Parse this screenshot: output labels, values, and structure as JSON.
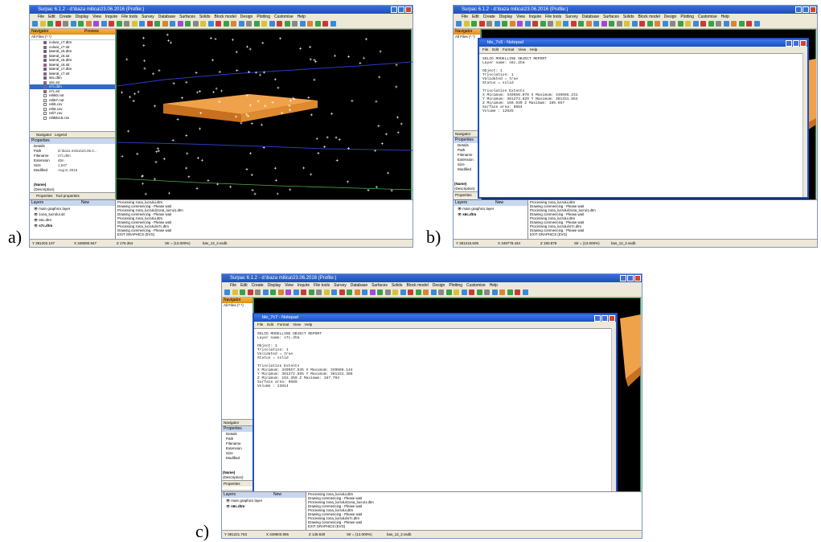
{
  "labels": {
    "a": "a)",
    "b": "b)",
    "c": "c)"
  },
  "app": {
    "titles": {
      "a": "Surpac 6.1.2 - d:\\baza mitica\\23.06.2016 (Profile:)",
      "b": "Surpac 6.1.2 - d:\\baza mitica\\23.06.2016 (Profile:)",
      "c": "Surpac 6.1.2 - d:\\baza mitica\\23.06.2016 (Profile:)"
    },
    "menu": [
      "File",
      "Edit",
      "Create",
      "Display",
      "View",
      "Inquire",
      "File tools",
      "Survey",
      "Database",
      "Surfaces",
      "Solids",
      "Block model",
      "Design",
      "Plotting",
      "Customise",
      "Help"
    ],
    "navigator": {
      "title": "Navigator",
      "preview": "Preview",
      "filter": "All Files (*.*)"
    },
    "files": [
      "culoar_c7.dtm",
      "culoar_c7.str",
      "lateral_c5.dtm",
      "lateral_c5.str",
      "lateral_c6.dtm",
      "lateral_c6.str",
      "lateral_c7.dtm",
      "lateral_c7.str",
      "s6c.dtm",
      "s6c.str",
      "s7c.dtm",
      "s7c.str",
      "reli60.not",
      "reli67.not",
      "reli5.csv",
      "reli6.csv",
      "reli7.csv",
      "reliBloc5.csv"
    ],
    "selected_file": "s7c.dtm",
    "nav_tabs": [
      "Navigator",
      "Legend"
    ],
    "properties": {
      "title": "Properties",
      "section": "Details",
      "rows": [
        {
          "k": "Path",
          "v": "D:\\baza mitica\\23.06.2..."
        },
        {
          "k": "Filename",
          "v": "s7c.dtm"
        },
        {
          "k": "Extension",
          "v": "dtm"
        },
        {
          "k": "Size",
          "v": "1,547"
        },
        {
          "k": "Modified",
          "v": "Aug 8, 2016"
        }
      ],
      "name_hint": "(Name)",
      "desc_hint": "(Description)",
      "tabs": [
        "Properties",
        "Tool properties"
      ]
    },
    "layers": {
      "title": "Layers",
      "new": "New",
      "items_a": [
        "main graphics layer",
        "zona_lucrului.str",
        "s6c.dtm",
        "s7c.dtm"
      ],
      "items_bc": [
        "main graphics layer",
        "s6c.dtm"
      ]
    },
    "log": [
      "Processing zona_lucrului.dtm",
      "Drawing commencing - Please wait",
      "Processing zona_lucrului\\zona_lucrui1.dtm",
      "Drawing commencing - Please wait",
      "Processing zona_lucrului.dtm",
      "Drawing commencing - Please wait",
      "Processing zona_lucrului\\s7c.dtm",
      "Drawing commencing - Please wait",
      "EXIT GRAPHICS (EVG)"
    ],
    "status": {
      "a": {
        "y": "Y 381202.107",
        "x": "X 349090.947",
        "z": "Z 176.354",
        "scale": "Str = (13.000%)",
        "db": "bas_12_2.ssdb"
      },
      "b": {
        "y": "Y 381216.605",
        "x": "X 349778.434",
        "z": "Z 150.878",
        "scale": "Str = (13.000%)",
        "db": "bas_12_2.ssdb"
      },
      "c": {
        "y": "Y 381221.763",
        "x": "X 349903.955",
        "z": "Z 145.630",
        "scale": "Str = (13.000%)",
        "db": "bas_12_2.ssdb"
      }
    }
  },
  "notepads": {
    "b": {
      "title": "ble_7c6 - Notepad",
      "menu": [
        "File",
        "Edit",
        "Format",
        "View",
        "Help"
      ],
      "lines": [
        "SOLID MODELLING OBJECT REPORT",
        "Layer name: s6c.dtm",
        "",
        "Object: 1",
        "Trisolation: 1",
        "Validated = true",
        "Status = solid",
        "",
        "Trisolation Extents",
        "X Minimum: 349556.078 X Maximum: 349665.231",
        "Y Minimum: 381273.629 Y Maximum: 381331.564",
        "Z Minimum: 160.930 Z Maximum: 185.657",
        "Surface area: 9684",
        "Volume : 12925"
      ]
    },
    "c": {
      "title": "ble_7c7 - Notepad",
      "menu": [
        "File",
        "Edit",
        "Format",
        "View",
        "Help"
      ],
      "lines": [
        "SOLID MODELLING OBJECT REPORT",
        "Layer name: s7c.dtm",
        "",
        "Object: 1",
        "Trisolation: 1",
        "Validated = true",
        "Status = solid",
        "",
        "Trisolation Extents",
        "X Minimum: 349557.535 X Maximum: 349666.144",
        "Y Minimum: 381272.555 Y Maximum: 381331.386",
        "Z Minimum: 163.350 Z Maximum: 167.794",
        "Surface area: 9689",
        "Volume : 13814"
      ]
    }
  }
}
